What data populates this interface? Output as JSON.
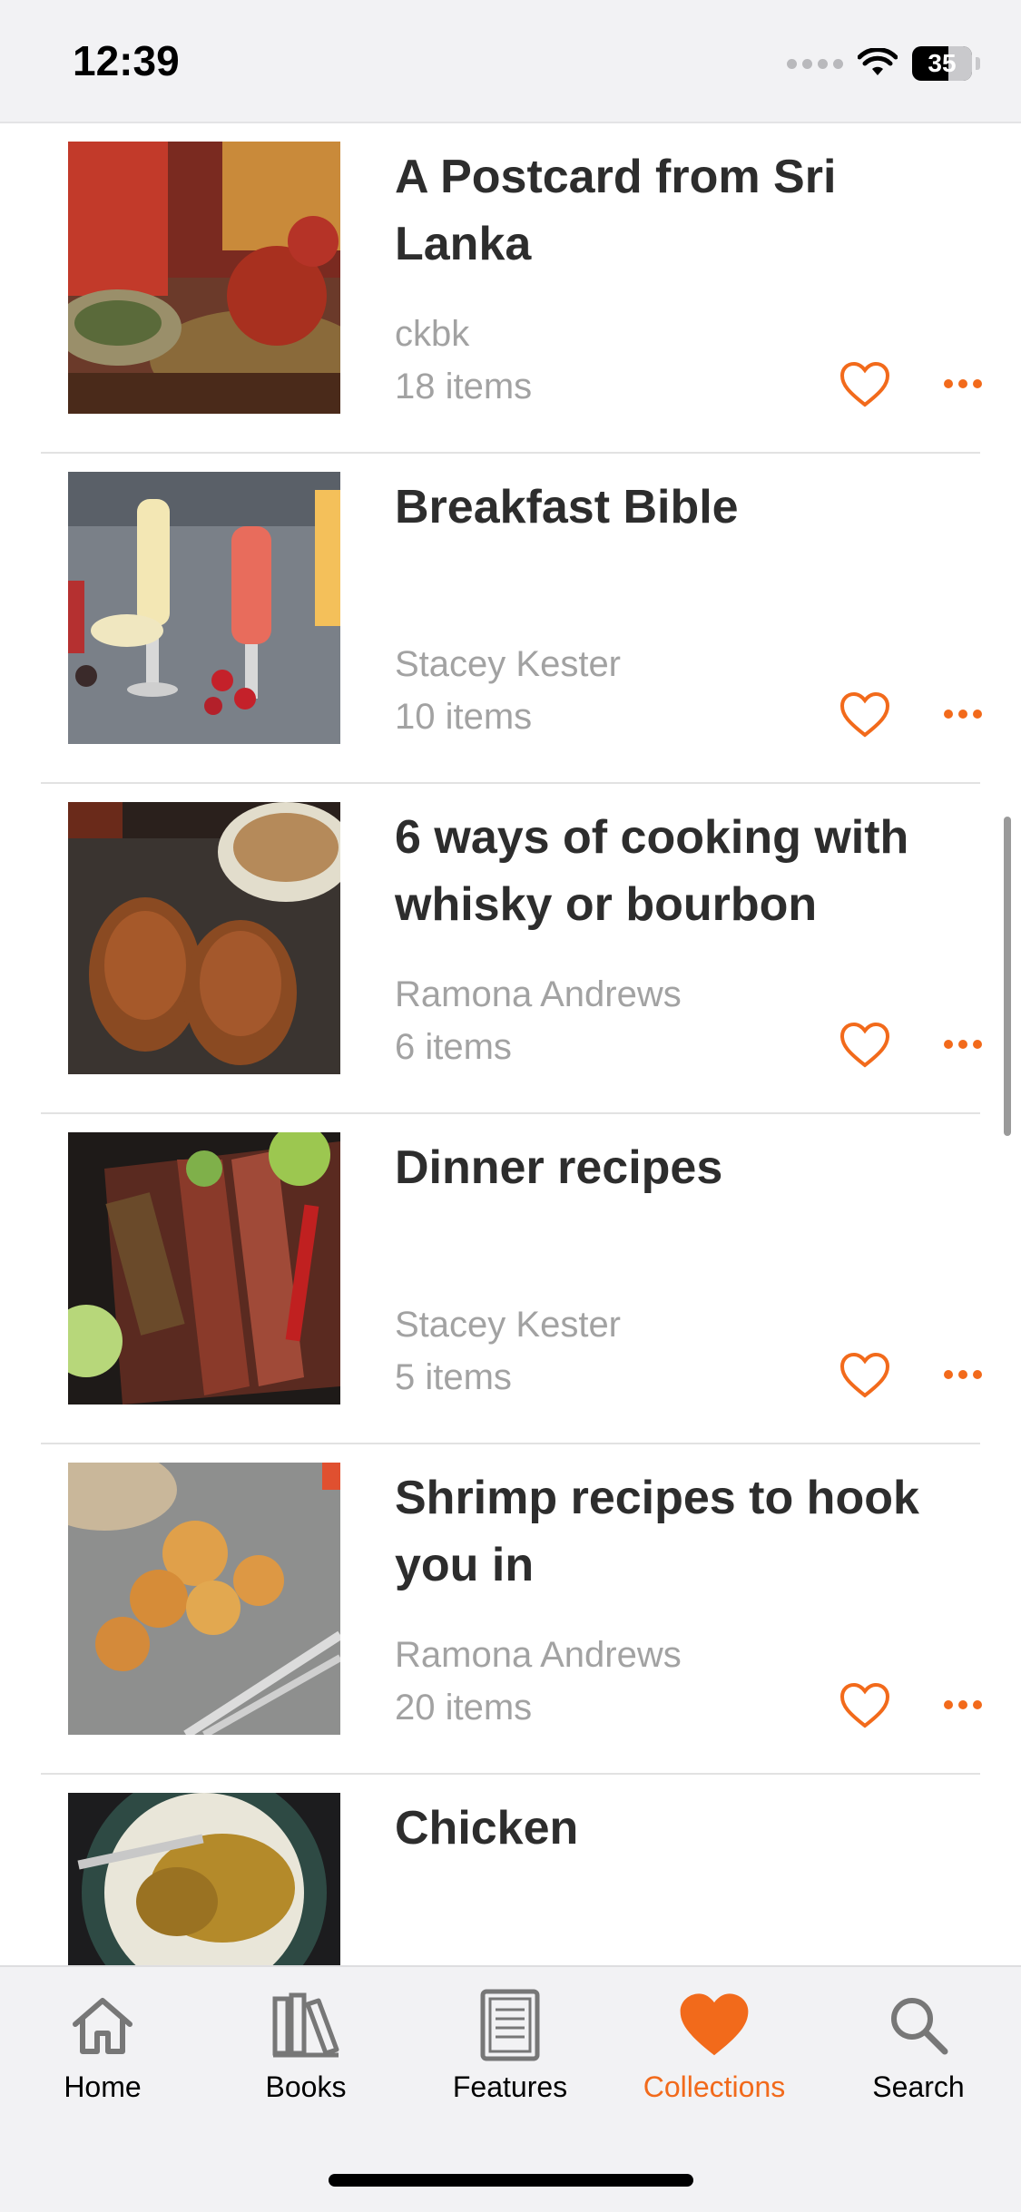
{
  "status_bar": {
    "time": "12:39",
    "battery": "35"
  },
  "collections": [
    {
      "title": "A Postcard from Sri Lanka",
      "author": "ckbk",
      "count": "18 items"
    },
    {
      "title": "Breakfast Bible",
      "author": "Stacey Kester",
      "count": "10 items"
    },
    {
      "title": "6 ways of cooking with whisky or bourbon",
      "author": "Ramona Andrews",
      "count": "6 items"
    },
    {
      "title": "Dinner recipes",
      "author": "Stacey Kester",
      "count": "5 items"
    },
    {
      "title": "Shrimp recipes to hook you in",
      "author": "Ramona Andrews",
      "count": "20 items"
    },
    {
      "title": "Chicken",
      "author": "",
      "count": ""
    }
  ],
  "tabs": [
    {
      "label": "Home",
      "icon": "house-icon"
    },
    {
      "label": "Books",
      "icon": "books-icon"
    },
    {
      "label": "Features",
      "icon": "newspaper-icon"
    },
    {
      "label": "Collections",
      "icon": "heart-icon",
      "active": true
    },
    {
      "label": "Search",
      "icon": "magnifier-icon"
    }
  ],
  "colors": {
    "accent": "#f26a1b",
    "text": "#2d2d2d",
    "secondary": "#a2a2a2",
    "bar": "#f2f2f4"
  }
}
